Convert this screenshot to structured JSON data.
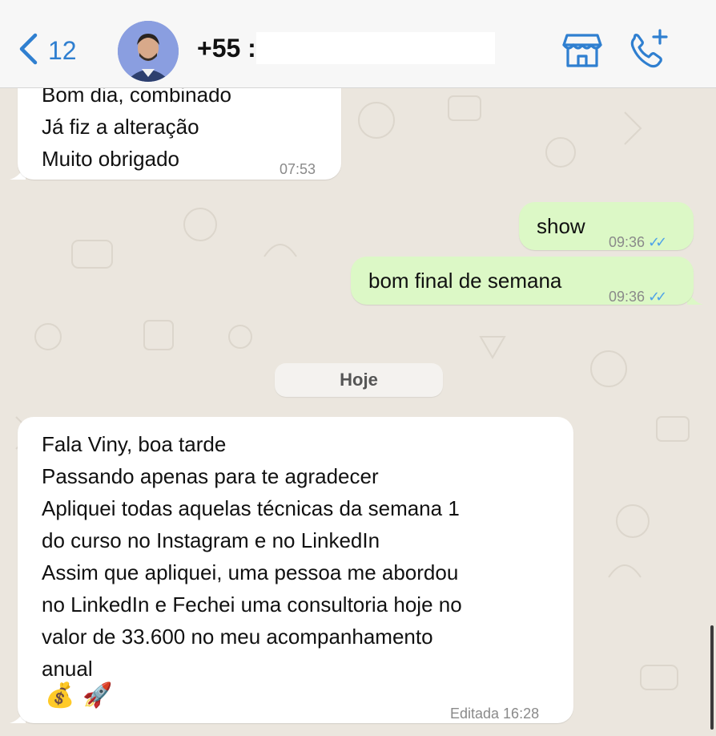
{
  "header": {
    "back_count": "12",
    "contact_name": "+55 :",
    "icons": {
      "back": "chevron-left-icon",
      "store": "store-icon",
      "call": "add-call-icon"
    },
    "accent_color": "#2f7fd0"
  },
  "messages": [
    {
      "direction": "incoming",
      "lines": [
        "Bom dia, combinado",
        "Já fiz a alteração",
        "Muito obrigado"
      ],
      "time": "07:53"
    },
    {
      "direction": "outgoing",
      "text": "show",
      "time": "09:36",
      "ticks": "✓✓"
    },
    {
      "direction": "outgoing",
      "text": "bom final de semana",
      "time": "09:36",
      "ticks": "✓✓"
    },
    {
      "direction": "incoming",
      "lines": [
        "Fala Viny, boa tarde",
        "Passando apenas para te agradecer",
        "Apliquei todas aquelas técnicas da semana 1",
        "do curso no Instagram e no LinkedIn",
        "Assim que apliquei, uma pessoa me abordou",
        "no LinkedIn e Fechei uma consultoria hoje no",
        "valor de 33.600 no meu acompanhamento",
        "anual"
      ],
      "emojis": [
        "💰",
        "🚀"
      ],
      "time": "Editada 16:28"
    }
  ],
  "date_separator": "Hoje",
  "colors": {
    "outgoing_bubble": "#dcf8c6",
    "incoming_bubble": "#ffffff",
    "read_ticks": "#4fa3e8",
    "chat_background": "#ebe6de"
  }
}
